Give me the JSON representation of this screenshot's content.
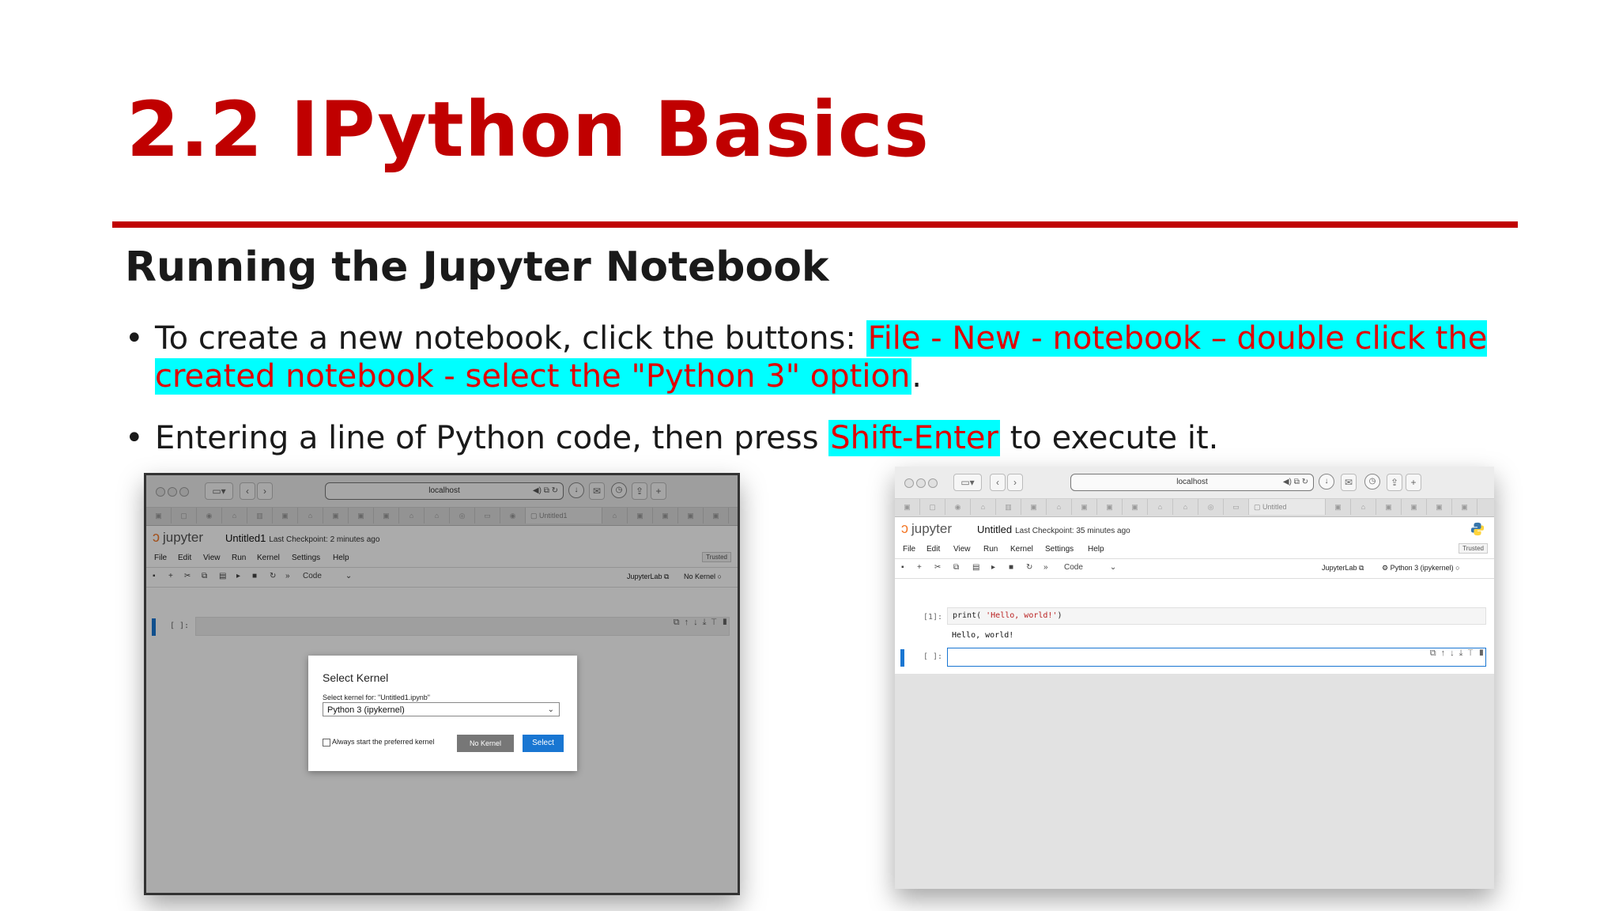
{
  "slide": {
    "title": "2.2 IPython Basics",
    "subtitle": "Running the Jupyter Notebook",
    "bullet1": {
      "prefix": "To create a new notebook, click the buttons: ",
      "highlight": "File - New - notebook – double click the created notebook - select the \"Python 3\" option",
      "suffix": "."
    },
    "bullet2": {
      "prefix": "Entering a line of Python code, then press ",
      "highlight": "Shift-Enter",
      "suffix": " to execute it."
    },
    "bullet_symbol": "•",
    "colors": {
      "title": "#c00000",
      "rule": "#c00000",
      "highlight_bg": "#00ffff",
      "highlight_text": "#e00000"
    }
  },
  "left_screenshot": {
    "url": "localhost",
    "tab_label": "Untitled1",
    "logo": "jupyter",
    "notebook_name": "Untitled1",
    "checkpoint": "Last Checkpoint: 2 minutes ago",
    "menu": [
      "File",
      "Edit",
      "View",
      "Run",
      "Kernel",
      "Settings",
      "Help"
    ],
    "trusted": "Trusted",
    "cell_type": "Code",
    "jupyterlab_link": "JupyterLab",
    "kernel_status": "No Kernel",
    "cell_prompt": "[ ]:",
    "dialog": {
      "title": "Select Kernel",
      "label": "Select kernel for: \"Untitled1.ipynb\"",
      "selected": "Python 3 (ipykernel)",
      "checkbox_label": "Always start the preferred kernel",
      "no_kernel_button": "No Kernel",
      "select_button": "Select"
    }
  },
  "right_screenshot": {
    "url": "localhost",
    "tab_label": "Untitled",
    "logo": "jupyter",
    "notebook_name": "Untitled",
    "checkpoint": "Last Checkpoint: 35 minutes ago",
    "menu": [
      "File",
      "Edit",
      "View",
      "Run",
      "Kernel",
      "Settings",
      "Help"
    ],
    "trusted": "Trusted",
    "cell_type": "Code",
    "jupyterlab_link": "JupyterLab",
    "kernel_status": "Python 3 (ipykernel)",
    "cell1_prompt": "[1]:",
    "cell1_code_fn": "print(",
    "cell1_code_str": " 'Hello, world!'",
    "cell1_code_end": ")",
    "cell1_output": "Hello, world!",
    "cell2_prompt": "[ ]:"
  }
}
